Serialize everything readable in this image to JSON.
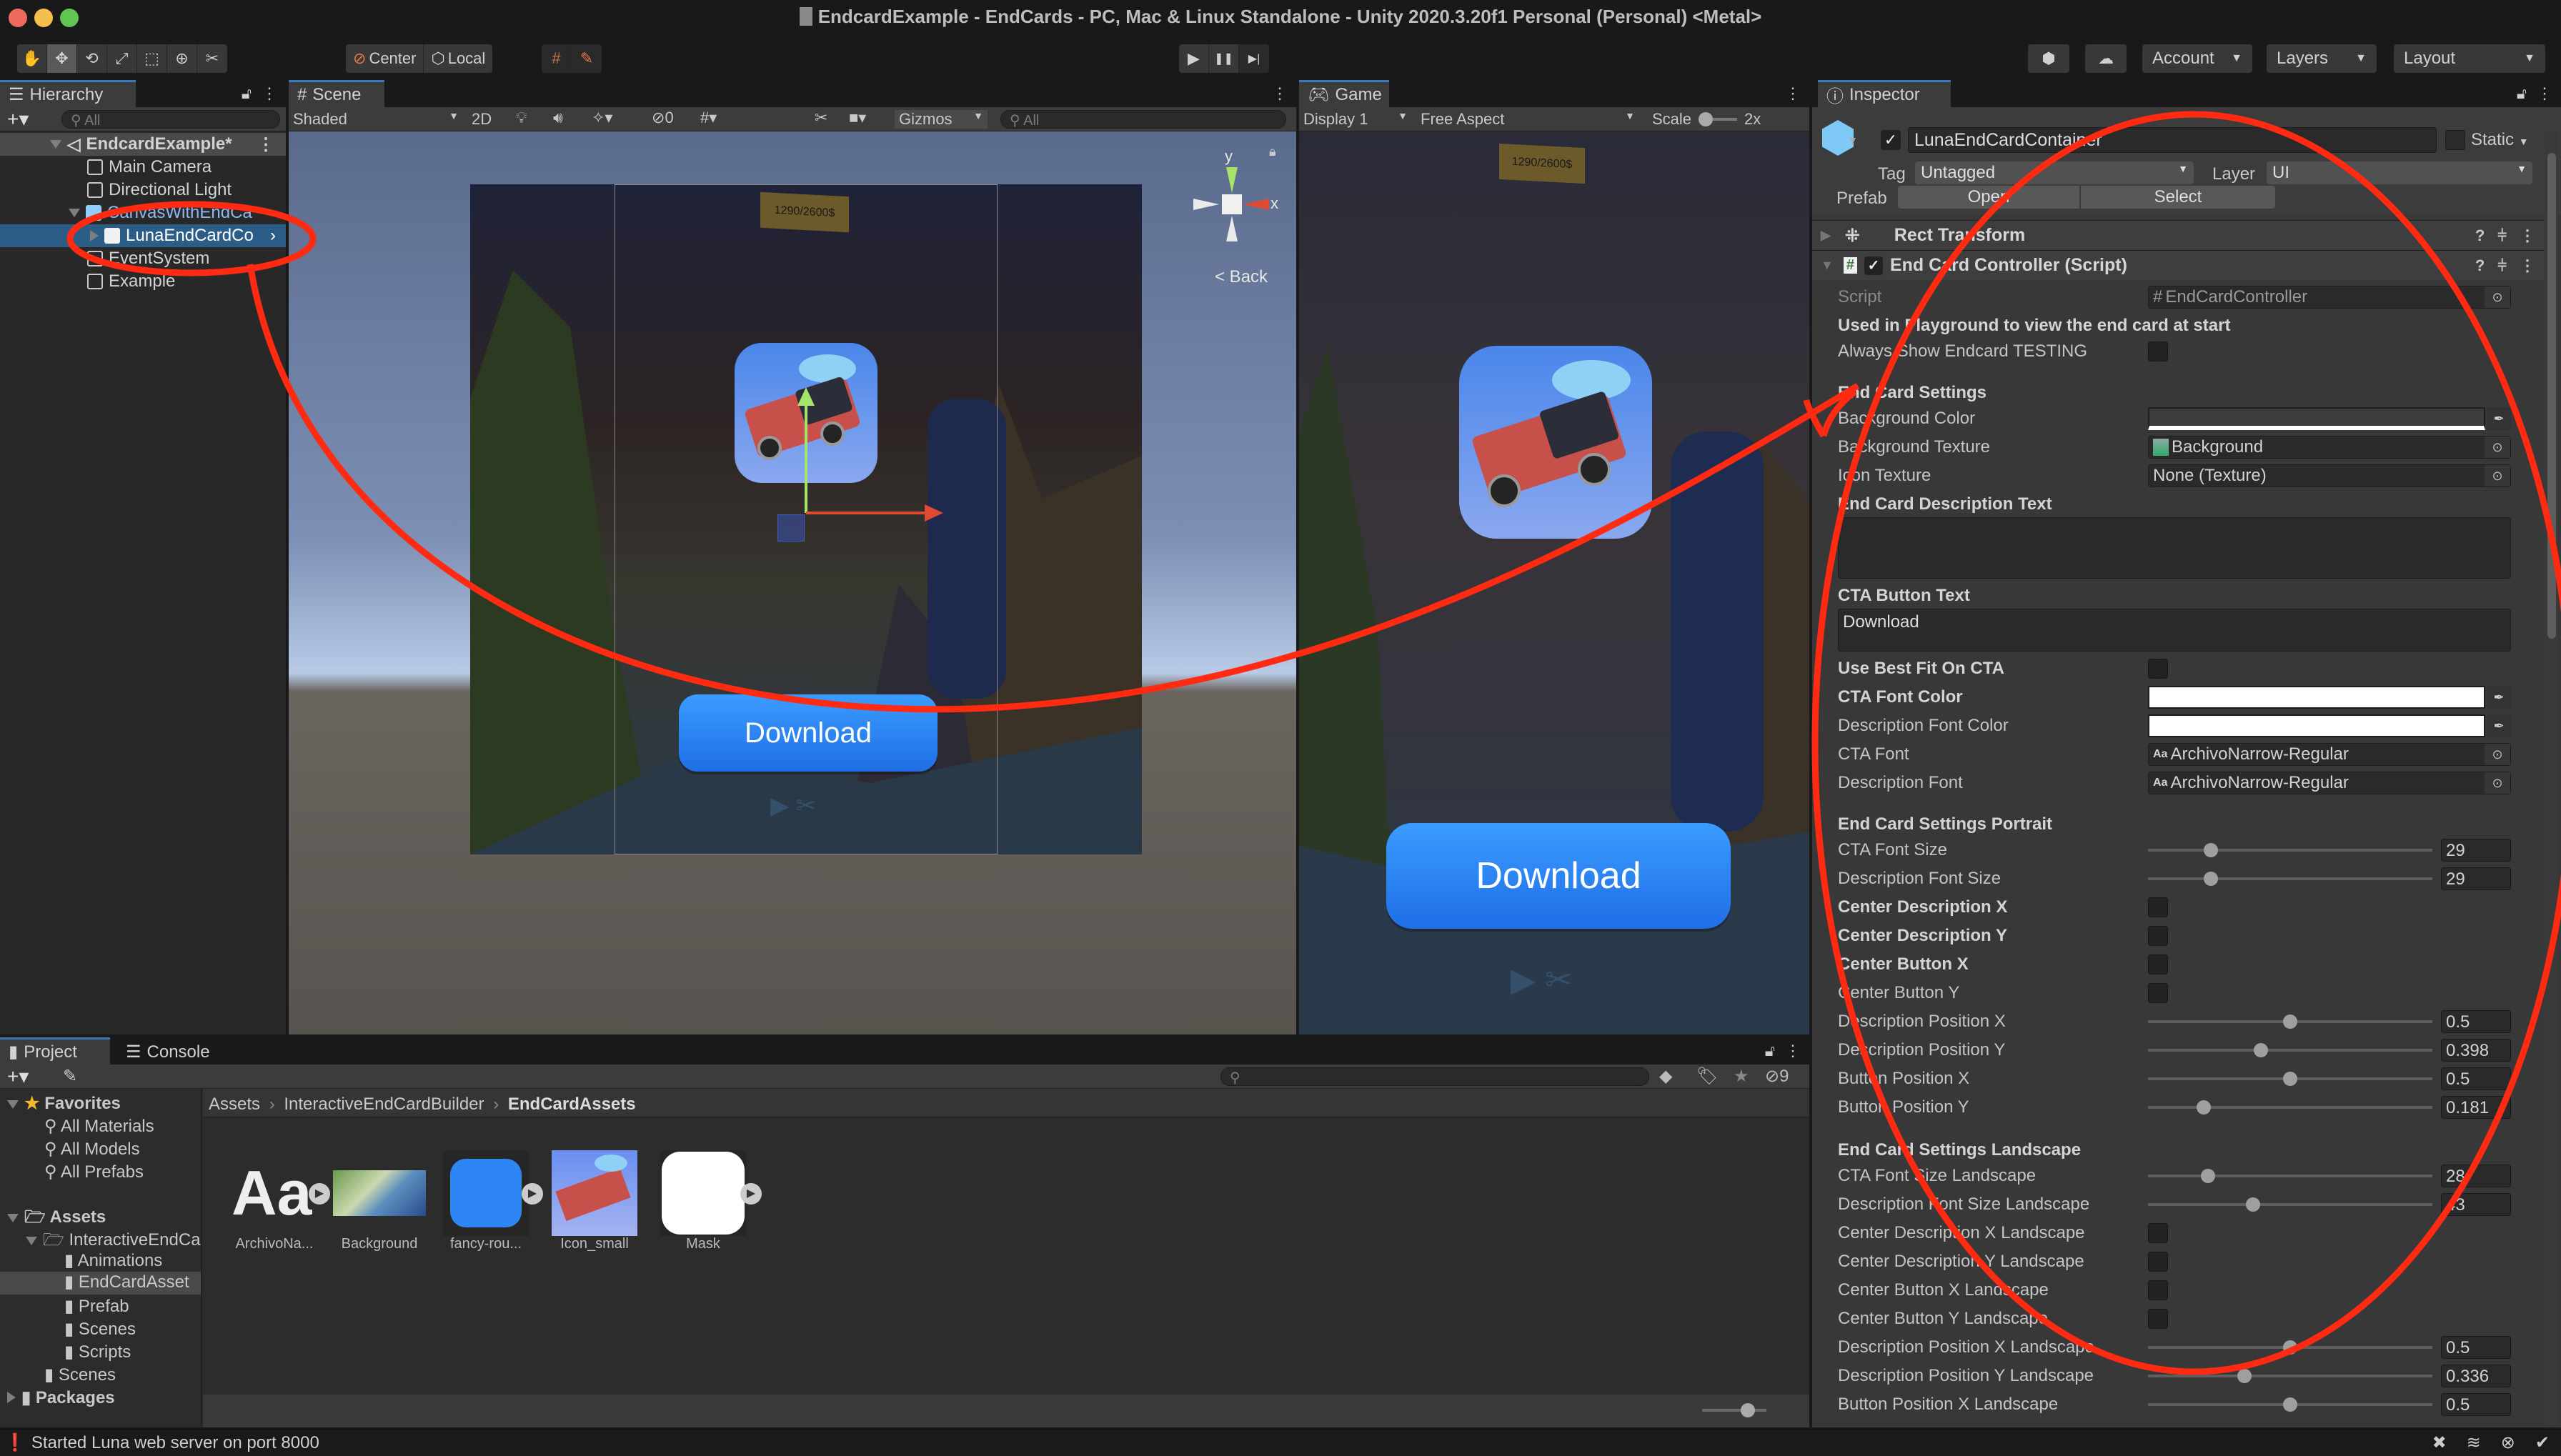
{
  "window": {
    "title": "EndcardExample - EndCards - PC, Mac & Linux Standalone - Unity 2020.3.20f1 Personal (Personal) <Metal>"
  },
  "toolbar": {
    "tools": [
      {
        "name": "hand-tool",
        "glyph": "✋"
      },
      {
        "name": "move-tool",
        "glyph": "✥"
      },
      {
        "name": "rotate-tool",
        "glyph": "⟲"
      },
      {
        "name": "scale-tool",
        "glyph": "⤢"
      },
      {
        "name": "rect-tool",
        "glyph": "⬚"
      },
      {
        "name": "transform-tool",
        "glyph": "⊕"
      },
      {
        "name": "custom-tool",
        "glyph": "✂"
      }
    ],
    "pivot_label": "Center",
    "space_label": "Local",
    "play_glyph": "▶",
    "pause_glyph": "❚❚",
    "step_glyph": "▶|",
    "account_label": "Account",
    "layers_label": "Layers",
    "layout_label": "Layout"
  },
  "hierarchy": {
    "tab_label": "Hierarchy",
    "search_placeholder": "All",
    "scene_name": "EndcardExample*",
    "items": [
      {
        "label": "Main Camera",
        "indent": 1
      },
      {
        "label": "Directional Light",
        "indent": 1
      },
      {
        "label": "CanvasWithEndCa",
        "indent": 1,
        "expanded": true,
        "prefab": true
      },
      {
        "label": "LunaEndCardCo",
        "indent": 2,
        "selected": true,
        "prefab": true
      },
      {
        "label": "EventSystem",
        "indent": 1
      },
      {
        "label": "Example",
        "indent": 1
      }
    ]
  },
  "scene": {
    "tab_label": "Scene",
    "shading_mode": "Shaded",
    "mode_2d": "2D",
    "hidden_count": "0",
    "gizmos_label": "Gizmos",
    "search_placeholder": "All",
    "back_label": "< Back",
    "axis_x": "x",
    "axis_y": "y",
    "score_text": "1290/2600$",
    "download_label": "Download"
  },
  "game": {
    "tab_label": "Game",
    "display": "Display 1",
    "aspect": "Free Aspect",
    "scale_label": "Scale",
    "scale_value": "2x",
    "download_label": "Download"
  },
  "inspector": {
    "tab_label": "Inspector",
    "object_name": "LunaEndCardContainer",
    "active": true,
    "static_label": "Static",
    "tag_label": "Tag",
    "tag_value": "Untagged",
    "layer_label": "Layer",
    "layer_value": "UI",
    "prefab_label": "Prefab",
    "open_label": "Open",
    "select_label": "Select",
    "rect_transform_label": "Rect Transform",
    "component_label": "End Card Controller (Script)",
    "script_label": "Script",
    "script_value": "EndCardController",
    "playground_header": "Used in Playground to view the end card at start",
    "always_show_label": "Always Show Endcard TESTING",
    "end_card_settings": "End Card Settings",
    "background_color_label": "Background Color",
    "background_texture_label": "Background Texture",
    "background_texture_value": "Background",
    "icon_texture_label": "Icon Texture",
    "icon_texture_value": "None (Texture)",
    "description_text_label": "End Card Description Text",
    "description_text_value": "",
    "cta_text_label": "CTA Button Text",
    "cta_text_value": "Download",
    "best_fit_label": "Use Best Fit On CTA",
    "cta_font_color_label": "CTA Font Color",
    "desc_font_color_label": "Description Font Color",
    "cta_font_label": "CTA Font",
    "cta_font_value": "ArchivoNarrow-Regular",
    "desc_font_label": "Description Font",
    "desc_font_value": "ArchivoNarrow-Regular",
    "font_glyph": "Aa",
    "portrait_header": "End Card Settings Portrait",
    "portrait_rows": [
      {
        "type": "slider",
        "label": "CTA Font Size",
        "value": "29",
        "fraction": 0.22
      },
      {
        "type": "slider",
        "label": "Description Font Size",
        "value": "29",
        "fraction": 0.22
      },
      {
        "type": "check",
        "label": "Center Description X",
        "bold": true
      },
      {
        "type": "check",
        "label": "Center Description Y",
        "bold": true
      },
      {
        "type": "check",
        "label": "Center Button X",
        "bold": true
      },
      {
        "type": "check",
        "label": "Center Button Y",
        "bold": false
      },
      {
        "type": "slider",
        "label": "Description Position X",
        "value": "0.5",
        "fraction": 0.5
      },
      {
        "type": "slider",
        "label": "Description Position Y",
        "value": "0.398",
        "fraction": 0.398
      },
      {
        "type": "slider",
        "label": "Button Position X",
        "value": "0.5",
        "fraction": 0.5
      },
      {
        "type": "slider",
        "label": "Button Position Y",
        "value": "0.181",
        "fraction": 0.195
      }
    ],
    "landscape_header": "End Card Settings Landscape",
    "landscape_rows": [
      {
        "type": "slider",
        "label": "CTA Font Size Landscape",
        "value": "28",
        "fraction": 0.21
      },
      {
        "type": "slider",
        "label": "Description Font Size Landscape",
        "value": "43",
        "fraction": 0.37
      },
      {
        "type": "check",
        "label": "Center Description X Landscape"
      },
      {
        "type": "check",
        "label": "Center Description Y Landscape"
      },
      {
        "type": "check",
        "label": "Center Button X Landscape"
      },
      {
        "type": "check",
        "label": "Center Button Y Landscape"
      },
      {
        "type": "slider",
        "label": "Description Position X Landscape",
        "value": "0.5",
        "fraction": 0.5
      },
      {
        "type": "slider",
        "label": "Description Position Y Landscape",
        "value": "0.336",
        "fraction": 0.34
      },
      {
        "type": "slider",
        "label": "Button Position X Landscape",
        "value": "0.5",
        "fraction": 0.5
      }
    ]
  },
  "project": {
    "tab_project": "Project",
    "tab_console": "Console",
    "hidden_count": "9",
    "favorites_label": "Favorites",
    "favorites": [
      "All Materials",
      "All Models",
      "All Prefabs"
    ],
    "assets_label": "Assets",
    "tree": [
      {
        "label": "InteractiveEndCa",
        "indent": 1,
        "expanded": true
      },
      {
        "label": "Animations",
        "indent": 2
      },
      {
        "label": "EndCardAsset",
        "indent": 2,
        "selected": true
      },
      {
        "label": "Prefab",
        "indent": 2
      },
      {
        "label": "Scenes",
        "indent": 2
      },
      {
        "label": "Scripts",
        "indent": 2
      },
      {
        "label": "Scenes",
        "indent": 1
      }
    ],
    "packages_label": "Packages",
    "breadcrumb": [
      "Assets",
      "InteractiveEndCardBuilder",
      "EndCardAssets"
    ],
    "assets": [
      {
        "label": "ArchivoNa...",
        "kind": "font"
      },
      {
        "label": "Background",
        "kind": "image"
      },
      {
        "label": "fancy-rou...",
        "kind": "sprite-blue"
      },
      {
        "label": "Icon_small",
        "kind": "icon"
      },
      {
        "label": "Mask",
        "kind": "sprite-white"
      }
    ]
  },
  "status": {
    "message": "Started Luna web server on port 8000"
  },
  "colors": {
    "annotation": "#ff2a12",
    "accent": "#3a79bb",
    "cta_blue": "#2e86f5"
  }
}
